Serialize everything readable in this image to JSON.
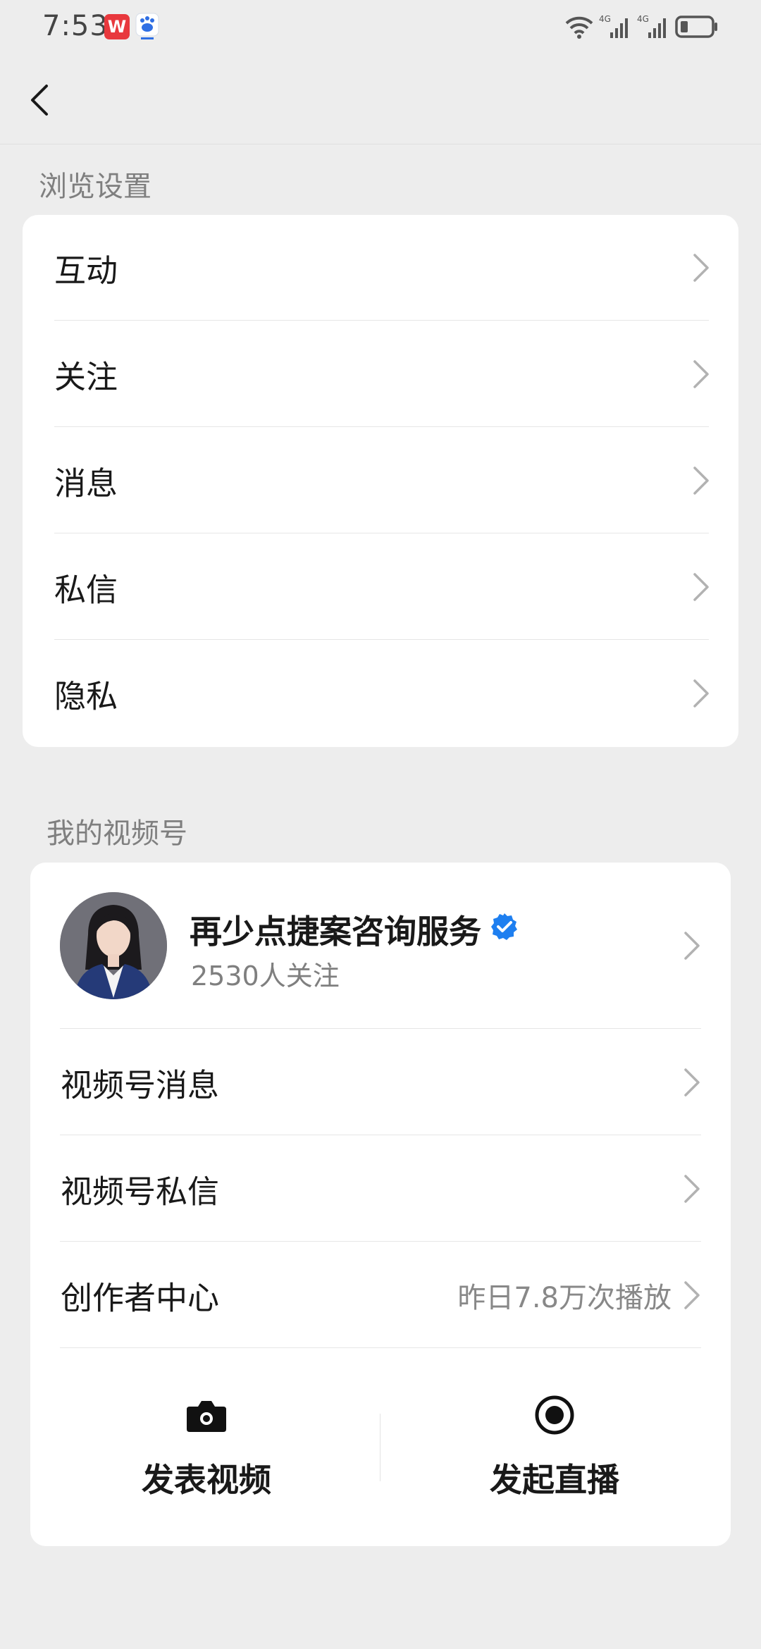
{
  "status_bar": {
    "time": "7:53",
    "wps_icon_label": "W",
    "network_1": "4G",
    "network_2": "4G"
  },
  "nav": {
    "back_icon": "back-arrow-icon"
  },
  "browse_settings": {
    "title": "浏览设置",
    "items": [
      {
        "label": "互动"
      },
      {
        "label": "关注"
      },
      {
        "label": "消息"
      },
      {
        "label": "私信"
      },
      {
        "label": "隐私"
      }
    ]
  },
  "channels": {
    "title": "我的视频号",
    "profile": {
      "name": "再少点捷案咨询服务",
      "followers": "2530人关注",
      "verified_color": "#1e7ff0"
    },
    "items": [
      {
        "label": "视频号消息",
        "value": ""
      },
      {
        "label": "视频号私信",
        "value": ""
      },
      {
        "label": "创作者中心",
        "value": "昨日7.8万次播放"
      }
    ],
    "actions": {
      "publish_video": "发表视频",
      "start_live": "发起直播"
    }
  },
  "colors": {
    "background": "#ededed",
    "card": "#ffffff",
    "secondary_text": "#7f7f7f",
    "verified_badge": "#1e7ff0",
    "wps_red": "#e8383d"
  }
}
